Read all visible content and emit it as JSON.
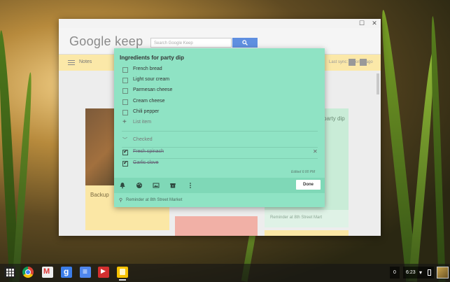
{
  "window": {
    "maximize_glyph": "☐",
    "close_glyph": "✕"
  },
  "keep": {
    "logo": "Google keep",
    "search_placeholder": "Search Google Keep",
    "notes_label": "Notes",
    "sync_label": "Last sync: seconds ago"
  },
  "background_cards": {
    "photo_note_text": "Backup",
    "green_note_text": "party dip",
    "reminder_text": "Reminder at 8th Street Mart"
  },
  "note": {
    "title": "Ingredients for party dip",
    "unchecked_items": [
      {
        "label": "French bread"
      },
      {
        "label": "Light sour cream"
      },
      {
        "label": "Parmesan cheese"
      },
      {
        "label": "Cream cheese"
      },
      {
        "label": "Chili pepper"
      }
    ],
    "add_item_label": "List item",
    "checked_section_label": "Checked",
    "checked_items": [
      {
        "label": "Fresh spinach"
      },
      {
        "label": "Garlic clove"
      }
    ],
    "edited_text": "Edited 6:00 PM",
    "done_label": "Done",
    "reminder_text": "Reminder at 8th Street Market"
  },
  "shelf": {
    "apps": [
      "launcher-icon",
      "chrome-icon",
      "gmail-icon",
      "google-search-icon",
      "docs-icon",
      "youtube-icon",
      "keep-icon"
    ],
    "notification_count": "0",
    "time": "6:23"
  }
}
